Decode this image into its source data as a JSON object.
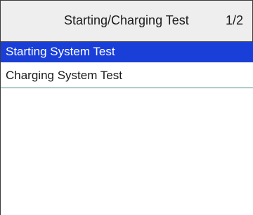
{
  "header": {
    "title": "Starting/Charging Test",
    "page_indicator": "1/2"
  },
  "menu": {
    "items": [
      {
        "label": "Starting System Test",
        "selected": true
      },
      {
        "label": "Charging System Test",
        "selected": false
      }
    ]
  },
  "colors": {
    "header_background": "#eeeeee",
    "selection_highlight": "#1a3fd8",
    "selected_text": "#ffffff",
    "divider": "#4a8c8a"
  }
}
